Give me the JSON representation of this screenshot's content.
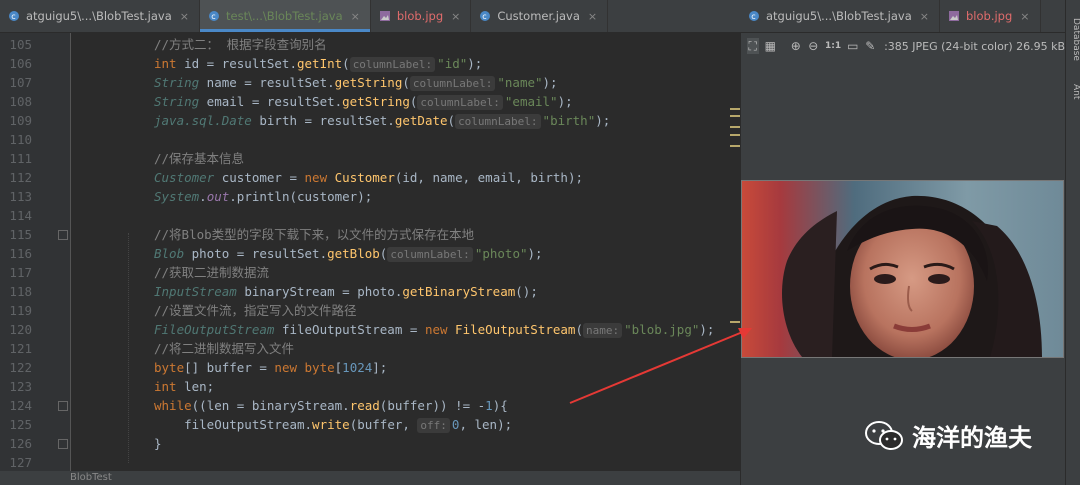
{
  "left_tabs": [
    {
      "label": "atguigu5\\...\\BlobTest.java",
      "color": "normal",
      "active": false
    },
    {
      "label": "test\\...\\BlobTest.java",
      "color": "green",
      "active": true
    },
    {
      "label": "blob.jpg",
      "color": "red",
      "active": false
    },
    {
      "label": "Customer.java",
      "color": "normal",
      "active": false
    }
  ],
  "right_tabs": [
    {
      "label": "atguigu5\\...\\BlobTest.java",
      "color": "normal"
    },
    {
      "label": "blob.jpg",
      "color": "red"
    }
  ],
  "close_glyph": "×",
  "code_lines": [
    {
      "n": "105",
      "html": "<span class='cm'>//方式二： 根据字段查询别名</span>"
    },
    {
      "n": "106",
      "html": "<span class='kw'>int</span> id = resultSet.<span class='fn'>getInt</span>(<span class='hint'>columnLabel:</span><span class='str'>\"id\"</span>);"
    },
    {
      "n": "107",
      "html": "<span class='ty'>String</span> name = resultSet.<span class='fn'>getString</span>(<span class='hint'>columnLabel:</span><span class='str'>\"name\"</span>);"
    },
    {
      "n": "108",
      "html": "<span class='ty'>String</span> email = resultSet.<span class='fn'>getString</span>(<span class='hint'>columnLabel:</span><span class='str'>\"email\"</span>);"
    },
    {
      "n": "109",
      "html": "<span class='ty'>java.sql.Date</span> birth = resultSet.<span class='fn'>getDate</span>(<span class='hint'>columnLabel:</span><span class='str'>\"birth\"</span>);"
    },
    {
      "n": "110",
      "html": ""
    },
    {
      "n": "111",
      "html": "<span class='cm'>//保存基本信息</span>"
    },
    {
      "n": "112",
      "html": "<span class='ty'>Customer</span> customer = <span class='kw'>new</span> <span class='fn'>Customer</span>(id, name, email, birth);"
    },
    {
      "n": "113",
      "html": "<span class='ty'>System</span>.<span class='it'>out</span>.println(customer);"
    },
    {
      "n": "114",
      "html": ""
    },
    {
      "n": "115",
      "html": "<span class='cm'>//将Blob类型的字段下载下来，以文件的方式保存在本地</span>"
    },
    {
      "n": "116",
      "html": "<span class='ty'>Blob</span> photo = resultSet.<span class='fn'>getBlob</span>(<span class='hint'>columnLabel:</span><span class='str'>\"photo\"</span>);"
    },
    {
      "n": "117",
      "html": "<span class='cm'>//获取二进制数据流</span>"
    },
    {
      "n": "118",
      "html": "<span class='ty'>InputStream</span> binaryStream = photo.<span class='fn'>getBinaryStream</span>();"
    },
    {
      "n": "119",
      "html": "<span class='cm'>//设置文件流，指定写入的文件路径</span>"
    },
    {
      "n": "120",
      "html": "<span class='ty'>FileOutputStream</span> fileOutputStream = <span class='kw'>new</span> <span class='fn'>FileOutputStream</span>(<span class='hint'>name:</span><span class='str'>\"blob.jpg\"</span>);"
    },
    {
      "n": "121",
      "html": "<span class='cm'>//将二进制数据写入文件</span>"
    },
    {
      "n": "122",
      "html": "<span class='kw'>byte</span>[] buffer = <span class='kw'>new</span> <span class='kw'>byte</span>[<span class='num'>1024</span>];"
    },
    {
      "n": "123",
      "html": "<span class='kw'>int</span> len;"
    },
    {
      "n": "124",
      "html": "<span class='kw'>while</span>((len = binaryStream.<span class='fn'>read</span>(buffer)) != -<span class='num'>1</span>){"
    },
    {
      "n": "125",
      "html": "    fileOutputStream.<span class='fn'>write</span>(buffer, <span class='hint'>off:</span><span class='num'>0</span>, len);"
    },
    {
      "n": "126",
      "html": "}"
    },
    {
      "n": "127",
      "html": ""
    }
  ],
  "status_text": "BlobTest",
  "viewer": {
    "info": ":385 JPEG (24-bit color) 26.95 kB",
    "zoom_label": "1:1",
    "tools": [
      "fit-icon",
      "grid-icon",
      "zoom-in-icon",
      "zoom-out-icon",
      "actual-size-icon",
      "background-icon",
      "color-picker-icon"
    ]
  },
  "sidebar": {
    "database": "Database",
    "ant": "Ant"
  },
  "watermark": {
    "text": "海洋的渔夫"
  },
  "colors": {
    "accent": "#4a88c7",
    "arrow": "#e53935"
  }
}
